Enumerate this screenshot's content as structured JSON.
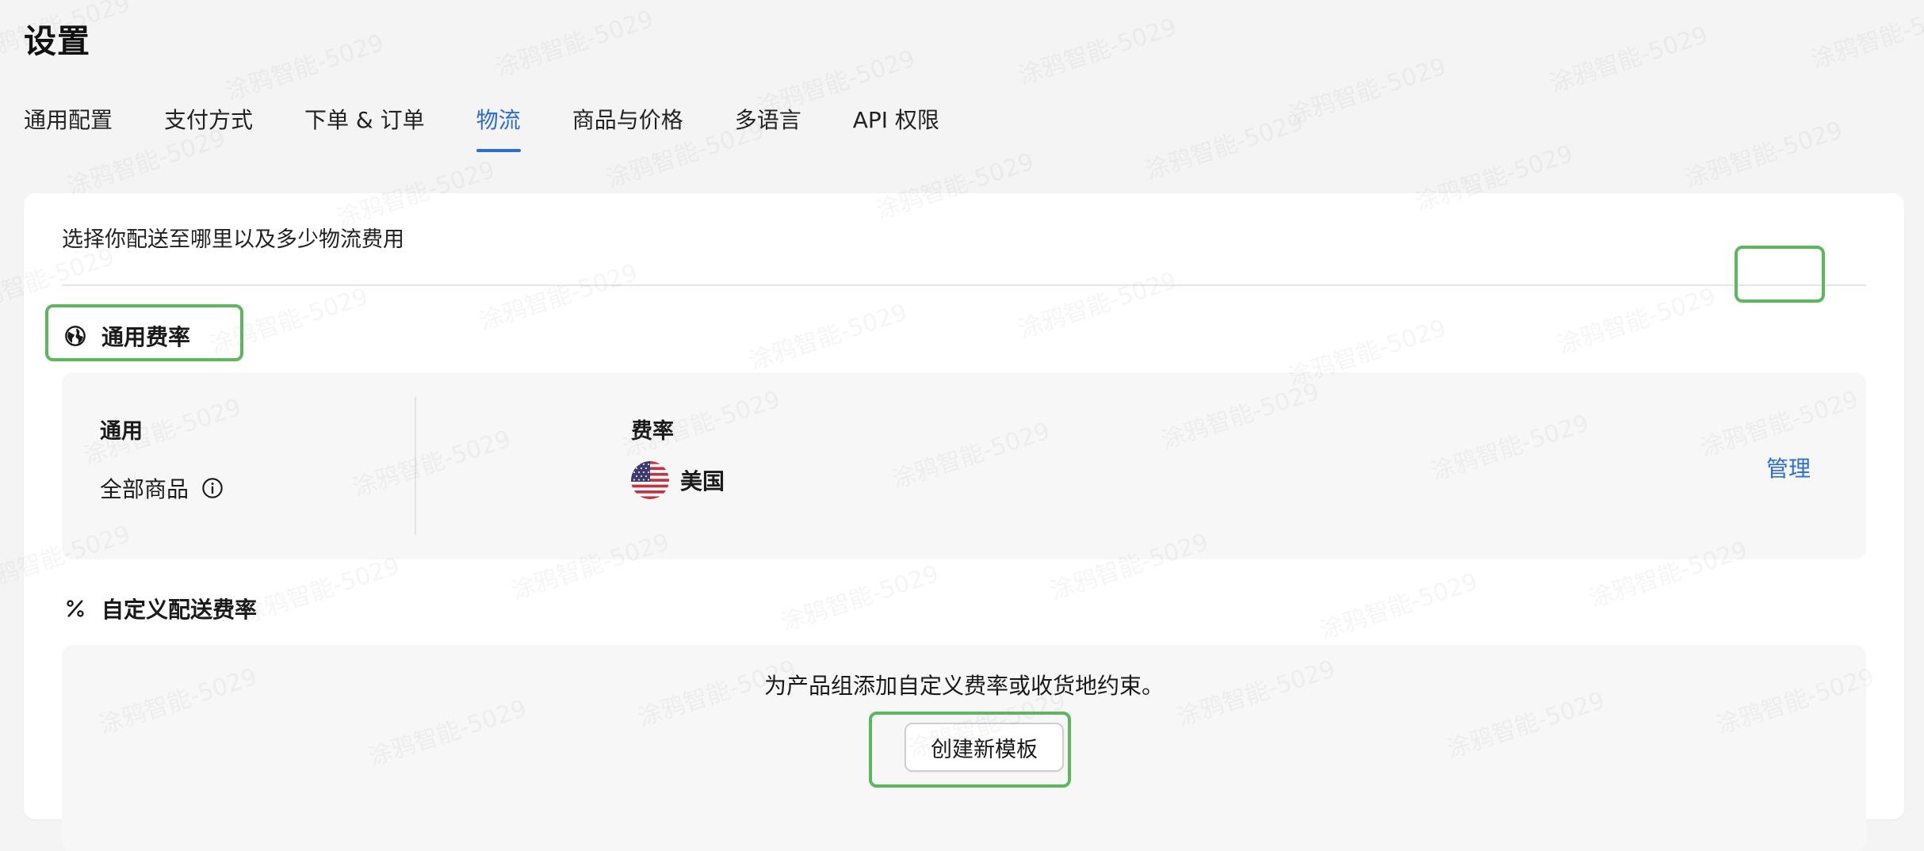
{
  "page": {
    "title": "设置"
  },
  "tabs": [
    {
      "label": "通用配置",
      "active": false
    },
    {
      "label": "支付方式",
      "active": false
    },
    {
      "label": "下单 & 订单",
      "active": false
    },
    {
      "label": "物流",
      "active": true
    },
    {
      "label": "商品与价格",
      "active": false
    },
    {
      "label": "多语言",
      "active": false
    },
    {
      "label": "API 权限",
      "active": false
    }
  ],
  "shipping": {
    "description": "选择你配送至哪里以及多少物流费用",
    "general_rate": {
      "title": "通用费率",
      "icon": "globe-icon",
      "column_general_label": "通用",
      "column_general_value": "全部商品",
      "column_rate_label": "费率",
      "rate_country": "美国",
      "rate_flag": "us-flag-icon",
      "manage_label": "管理"
    },
    "custom_rate": {
      "title": "自定义配送费率",
      "icon": "percent-icon",
      "hint": "为产品组添加自定义费率或收货地约束。",
      "create_button_label": "创建新模板"
    }
  },
  "watermark": {
    "text": "涂鸦智能-5029"
  },
  "colors": {
    "accent": "#2b6cde",
    "highlight": "#5cb85c",
    "background": "#f4f4f5",
    "card": "#ffffff",
    "panel": "#f7f7f8"
  }
}
